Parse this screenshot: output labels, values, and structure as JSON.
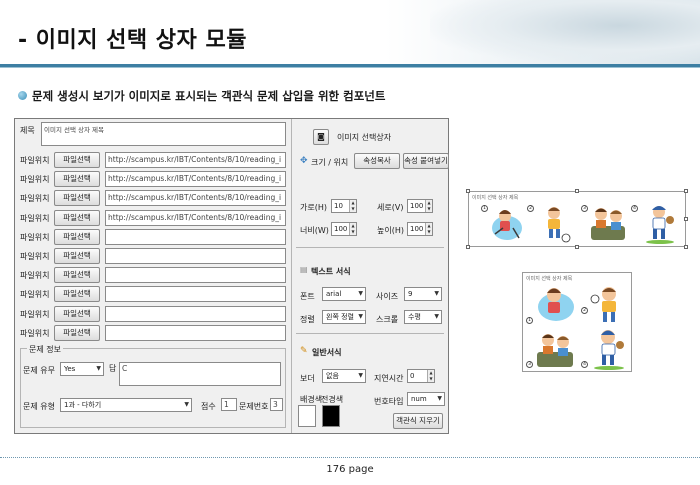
{
  "slide": {
    "title": "- 이미지 선택 상자 모듈",
    "subtitle": "문제 생성시 보기가 이미지로 표시되는 객관식 문제 삽입을 위한 컴포넌트",
    "page": "176 page"
  },
  "left": {
    "title_label": "제목",
    "title_value": "이미지 선택 상자 제목",
    "file_label": "파일위치",
    "file_button": "파일선택",
    "files": [
      "http://scampus.kr/IBT/Contents/8/10/reading_i",
      "http://scampus.kr/IBT/Contents/8/10/reading_i",
      "http://scampus.kr/IBT/Contents/8/10/reading_i",
      "http://scampus.kr/IBT/Contents/8/10/reading_i",
      "",
      "",
      "",
      "",
      "",
      ""
    ],
    "info": {
      "group_label": "문제 정보",
      "has_question_label": "문제 유무",
      "has_question_value": "Yes",
      "answer_label": "답",
      "answer_value": "C",
      "type_label": "문제 유형",
      "type_value": "1과 - 다하기",
      "score_label": "점수",
      "score_value": "1",
      "number_label": "문제번호",
      "number_value": "3"
    }
  },
  "right": {
    "component_label": "이미지 선택상자",
    "size_pos_label": "크기 / 위치",
    "copy_attr_button": "속성복사",
    "paste_attr_button": "속성 붙여넣기",
    "h_label": "가로(H)",
    "h_value": "10",
    "v_label": "세로(V)",
    "v_value": "100",
    "w_label": "너비(W)",
    "w_value": "100",
    "height_label": "높이(H)",
    "height_value": "100",
    "text_format_label": "텍스트 서식",
    "font_label": "폰트",
    "font_value": "arial",
    "size_label": "사이즈",
    "size_value": "9",
    "align_label": "정렬",
    "align_value": "왼쪽 정렬",
    "scroll_label": "스크롤",
    "scroll_value": "수평",
    "general_format_label": "일반서식",
    "border_label": "보더",
    "border_value": "없음",
    "delay_label": "지연시간",
    "delay_value": "0",
    "bg_label": "배경색",
    "fg_label": "전경색",
    "num_type_label": "번호타입",
    "num_type_value": "num",
    "clear_answer_button": "객관식 지우기",
    "colors": {
      "bg": "#ffffff",
      "fg": "#000000"
    }
  },
  "preview": {
    "caption_top": "이미지 선택 상자 제목",
    "caption_bottom": "이미지 선택 상자 제목",
    "numbers": [
      "1",
      "2",
      "3",
      "4"
    ]
  }
}
